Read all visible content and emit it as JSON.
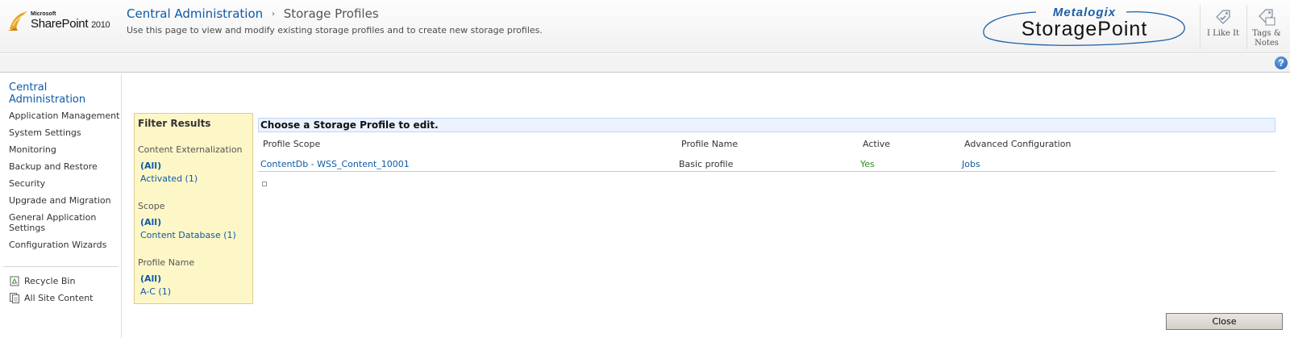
{
  "header": {
    "logo_vendor": "Microsoft",
    "logo_product": "SharePoint",
    "logo_version": "2010",
    "breadcrumb_root": "Central Administration",
    "breadcrumb_separator": "›",
    "breadcrumb_current": "Storage Profiles",
    "description": "Use this page to view and modify existing storage profiles and to create new storage profiles.",
    "brand_top": "Metalogix",
    "brand_main": "StoragePoint",
    "i_like_it_label": "I Like It",
    "tags_notes_label_1": "Tags &",
    "tags_notes_label_2": "Notes",
    "help_glyph": "?"
  },
  "leftnav": {
    "heading_1": "Central",
    "heading_2": "Administration",
    "items": [
      {
        "label": "Application Management"
      },
      {
        "label": "System Settings"
      },
      {
        "label": "Monitoring"
      },
      {
        "label": "Backup and Restore"
      },
      {
        "label": "Security"
      },
      {
        "label": "Upgrade and Migration"
      },
      {
        "label": "General Application Settings"
      },
      {
        "label": "Configuration Wizards"
      }
    ],
    "recycle_bin": "Recycle Bin",
    "all_site_content": "All Site Content"
  },
  "filter": {
    "title": "Filter Results",
    "groups": [
      {
        "name": "Content Externalization",
        "all": "(All)",
        "option": "Activated (1)"
      },
      {
        "name": "Scope",
        "all": "(All)",
        "option": "Content Database (1)"
      },
      {
        "name": "Profile Name",
        "all": "(All)",
        "option": "A-C (1)"
      }
    ]
  },
  "grid": {
    "title": "Choose a Storage Profile to edit.",
    "columns": [
      "Profile Scope",
      "Profile Name",
      "Active",
      "Advanced Configuration"
    ],
    "rows": [
      {
        "scope": "ContentDb - WSS_Content_10001",
        "name": "Basic profile",
        "active": "Yes",
        "advanced": "Jobs"
      }
    ]
  },
  "footer": {
    "close_label": "Close"
  },
  "colors": {
    "link": "#0d5aa7",
    "filter_background": "#fdf7c8",
    "title_bar": "#ebf3ff",
    "active_green": "#2f8a1e"
  },
  "icons": [
    "sharepoint-logo-icon",
    "i-like-it-icon",
    "tags-notes-icon",
    "help-icon",
    "recycle-bin-icon",
    "all-site-content-icon"
  ]
}
